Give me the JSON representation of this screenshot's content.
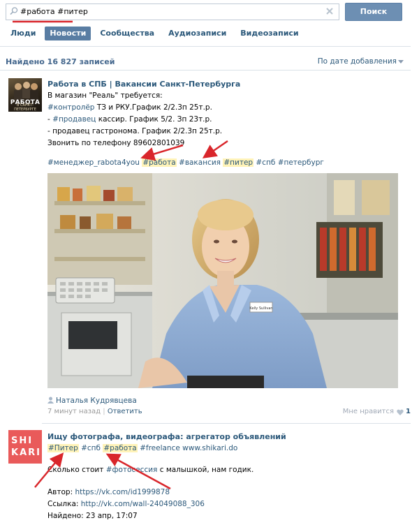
{
  "search": {
    "query": "#работа #питер",
    "button_label": "Поиск"
  },
  "tabs": [
    {
      "label": "Люди",
      "active": false
    },
    {
      "label": "Новости",
      "active": true
    },
    {
      "label": "Сообщества",
      "active": false
    },
    {
      "label": "Аудиозаписи",
      "active": false
    },
    {
      "label": "Видеозаписи",
      "active": false
    }
  ],
  "results": {
    "count_text": "Найдено 16 827 записей",
    "sort_label": "По дате добавления"
  },
  "post1": {
    "avatar_text": "РАБОТА",
    "avatar_sub": "В САНКТ-ПЕТЕРБУРГЕ",
    "title": "Работа в СПБ | Вакансии Санкт-Петербурга",
    "lines": [
      "В магазин \"Реаль\" требуется:",
      "- #контролёр ТЗ и РКУ.График 2/2.3п 25т.р.",
      "- #продавец кассир. График 5/2. Зп 23т.р.",
      "- продавец гастронома. График 2/2.3п 25т.р.",
      "Звонить по телефону 89602801039"
    ],
    "hashtags": [
      "#менеджер_rabota4you",
      "#работа",
      "#вакансия",
      "#питер",
      "#спб",
      "#петербург"
    ],
    "author": "Наталья Кудрявцева",
    "time": "7 минут назад",
    "reply": "Ответить",
    "likes_label": "Мне нравится",
    "likes_count": "1",
    "badge_text": "Kelly Sullivan"
  },
  "post2": {
    "avatar_line1": "SHI",
    "avatar_line2": "KARI",
    "title": "Ищу фотографа, видеографа: агрегатор объявлений",
    "tags": [
      "#Питер",
      "#спб",
      "#работа",
      "#freelance",
      "www.shikari.do"
    ],
    "text": "Сколько стоит #фотосессия с малышкой, нам годик.",
    "author_label": "Автор:",
    "author_link": "https://vk.com/id1999878",
    "link_label": "Ссылка:",
    "link_url": "http://vk.com/wall-24049088_306",
    "found_label": "Найдено:",
    "found_date": "23 апр, 17:07"
  },
  "colors": {
    "link": "#2b587a",
    "button": "#6d8fb3",
    "active_tab": "#597da3",
    "highlight": "#fff3b8",
    "arrow": "#d9262b"
  }
}
